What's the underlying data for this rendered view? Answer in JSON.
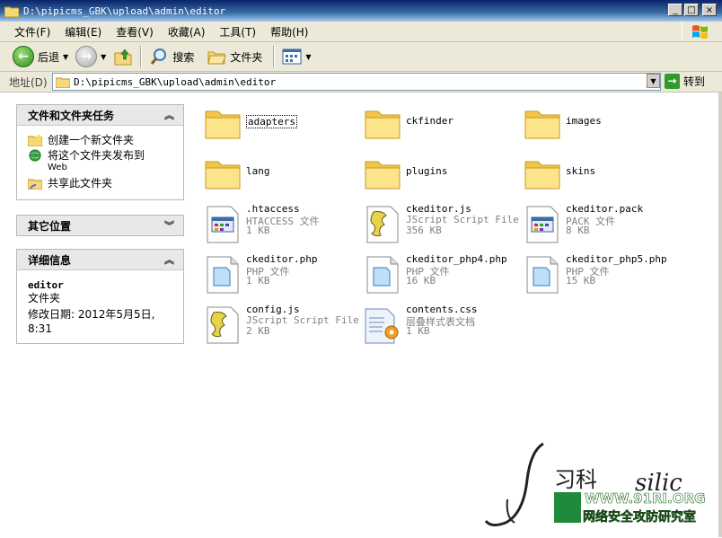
{
  "window": {
    "title": "D:\\pipicms_GBK\\upload\\admin\\editor",
    "min": "_",
    "max": "□",
    "close": "×"
  },
  "menu": [
    "文件(F)",
    "编辑(E)",
    "查看(V)",
    "收藏(A)",
    "工具(T)",
    "帮助(H)"
  ],
  "toolbar": {
    "back": "后退",
    "search": "搜索",
    "folders": "文件夹"
  },
  "address": {
    "label": "地址(D)",
    "value": "D:\\pipicms_GBK\\upload\\admin\\editor",
    "go": "转到"
  },
  "panes": {
    "tasks": {
      "title": "文件和文件夹任务",
      "items": [
        {
          "label": "创建一个新文件夹"
        },
        {
          "label": "将这个文件夹发布到",
          "sub": "Web"
        },
        {
          "label": "共享此文件夹"
        }
      ]
    },
    "other": {
      "title": "其它位置"
    },
    "details": {
      "title": "详细信息",
      "name": "editor",
      "kind": "文件夹",
      "modified_line1": "修改日期: 2012年5月5日,",
      "modified_line2": "8:31"
    }
  },
  "files": [
    {
      "name": "adapters",
      "kind": "folder"
    },
    {
      "name": "ckfinder",
      "kind": "folder"
    },
    {
      "name": "images",
      "kind": "folder"
    },
    {
      "name": "lang",
      "kind": "folder"
    },
    {
      "name": "plugins",
      "kind": "folder"
    },
    {
      "name": "skins",
      "kind": "folder"
    },
    {
      "name": ".htaccess",
      "type": "HTACCESS 文件",
      "size": "1 KB",
      "icon": "generic-file-icon"
    },
    {
      "name": "ckeditor.js",
      "type": "JScript Script File",
      "size": "356 KB",
      "icon": "script-file-icon"
    },
    {
      "name": "ckeditor.pack",
      "type": "PACK 文件",
      "size": "8 KB",
      "icon": "generic-file-icon"
    },
    {
      "name": "ckeditor.php",
      "type": "PHP 文件",
      "size": "1 KB",
      "icon": "php-file-icon"
    },
    {
      "name": "ckeditor_php4.php",
      "type": "PHP 文件",
      "size": "16 KB",
      "icon": "php-file-icon"
    },
    {
      "name": "ckeditor_php5.php",
      "type": "PHP 文件",
      "size": "15 KB",
      "icon": "php-file-icon"
    },
    {
      "name": "config.js",
      "type": "JScript Script File",
      "size": "2 KB",
      "icon": "script-file-icon"
    },
    {
      "name": "contents.css",
      "type": "层叠样式表文档",
      "size": "1 KB",
      "icon": "css-file-icon"
    }
  ],
  "watermark": {
    "cn_top": "习科",
    "latin": "silic",
    "site": "WWW.91RI.ORG",
    "cn_bottom": "网络安全攻防研究室"
  }
}
